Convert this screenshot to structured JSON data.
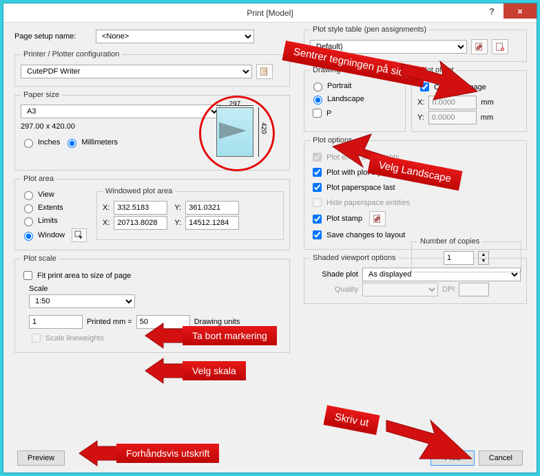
{
  "window": {
    "title": "Print [Model]",
    "help": "?",
    "close": "×"
  },
  "page_setup": {
    "label": "Page setup name:",
    "value": "<None>"
  },
  "printer": {
    "legend": "Printer / Plotter configuration",
    "value": "CutePDF Writer"
  },
  "paper": {
    "legend": "Paper size",
    "value": "A3",
    "dims_text": "297.00 x 420.00",
    "inches": "Inches",
    "mm": "Millimeters",
    "dim_w": "297",
    "dim_h": "420"
  },
  "plotarea": {
    "legend": "Plot area",
    "view": "View",
    "extents": "Extents",
    "limits": "Limits",
    "window": "Window",
    "winlegend": "Windowed plot area",
    "x1_lbl": "X:",
    "x1": "332.5183",
    "y1_lbl": "Y:",
    "y1": "361.0321",
    "x2_lbl": "X:",
    "x2": "20713.8028",
    "y2_lbl": "Y:",
    "y2": "14512.1284"
  },
  "plotscale": {
    "legend": "Plot scale",
    "fit": "Fit print area to size of page",
    "scale_lbl": "Scale",
    "scale": "1:50",
    "left": "1",
    "mid": "Printed mm  =",
    "right": "50",
    "du": "Drawing units",
    "sl": "Scale lineweights"
  },
  "pst": {
    "legend": "Plot style table (pen assignments)",
    "value": "Default)"
  },
  "orient": {
    "legend": "Drawing",
    "portrait": "Portrait",
    "landscape": "Landscape",
    "upside": "P"
  },
  "offset": {
    "legend": "Plot offset",
    "center": "Center on page",
    "xl": "X:",
    "x": "0.0000",
    "yl": "Y:",
    "y": "0.0000",
    "unit": "mm"
  },
  "popts": {
    "legend": "Plot options",
    "a": "Plot entity lineweights",
    "b": "Plot with plot styles",
    "c": "Plot paperspace last",
    "d": "Hide paperspace entities",
    "e": "Plot stamp",
    "f": "Save changes to layout"
  },
  "shaded": {
    "legend": "Shaded viewport options",
    "splot": "Shade plot",
    "sval": "As displayed",
    "quality": "Quality",
    "dpi": "DPI"
  },
  "copies": {
    "label": "Number of copies",
    "value": "1"
  },
  "buttons": {
    "preview": "Preview",
    "print": "Print",
    "cancel": "Cancel"
  },
  "callouts": {
    "center": "Sentrer tegningen på siden",
    "landscape": "Velg Landscape",
    "fit": "Ta bort markering",
    "scale": "Velg skala",
    "preview": "Forhåndsvis utskrift",
    "print": "Skriv ut"
  }
}
